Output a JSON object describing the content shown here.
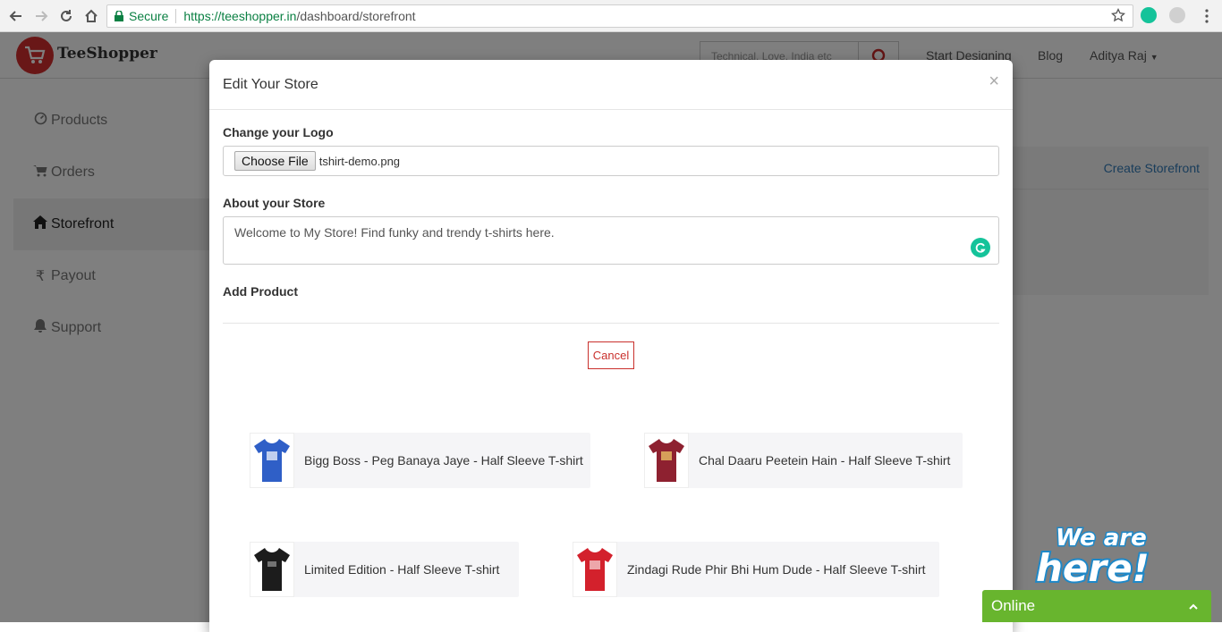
{
  "browser": {
    "secure_label": "Secure",
    "url_host": "https://teeshopper.in",
    "url_path": "/dashboard/storefront"
  },
  "site": {
    "brand_name": "TeeShopper",
    "search_placeholder": "Technical, Love, India etc",
    "nav": [
      "Start Designing",
      "Blog",
      "Aditya Raj"
    ],
    "sidebar": [
      {
        "label": "Products",
        "icon": "dashboard-icon",
        "active": false
      },
      {
        "label": "Orders",
        "icon": "cart-icon",
        "active": false
      },
      {
        "label": "Storefront",
        "icon": "home-icon",
        "active": true
      },
      {
        "label": "Payout",
        "icon": "rupee-icon",
        "active": false
      },
      {
        "label": "Support",
        "icon": "bell-icon",
        "active": false
      }
    ],
    "create_storefront": "Create Storefront"
  },
  "modal": {
    "title": "Edit Your Store",
    "close": "×",
    "logo_label": "Change your Logo",
    "choose_file": "Choose File",
    "file_name": "tshirt-demo.png",
    "about_label": "About your Store",
    "about_text": "Welcome to My Store! Find funky and trendy t-shirts here.",
    "add_product_label": "Add Product",
    "cancel": "Cancel",
    "products": [
      {
        "name": "Bigg Boss - Peg Banaya Jaye - Half Sleeve T-shirt",
        "color": "#2f5fc7"
      },
      {
        "name": "Chal Daaru Peetein Hain - Half Sleeve T-shirt",
        "color": "#8e2130"
      },
      {
        "name": "Limited Edition - Half Sleeve T-shirt",
        "color": "#1c1c1c"
      },
      {
        "name": "Zindagi Rude Phir Bhi Hum Dude - Half Sleeve T-shirt",
        "color": "#d3212c"
      }
    ]
  },
  "chat": {
    "badge_line1": "We are",
    "badge_line2": "here!",
    "status": "Online"
  },
  "colors": {
    "accent_link": "#337ab7",
    "cancel_red": "#c9302c",
    "chat_green": "#68b52e",
    "secure_green": "#0b8043"
  }
}
